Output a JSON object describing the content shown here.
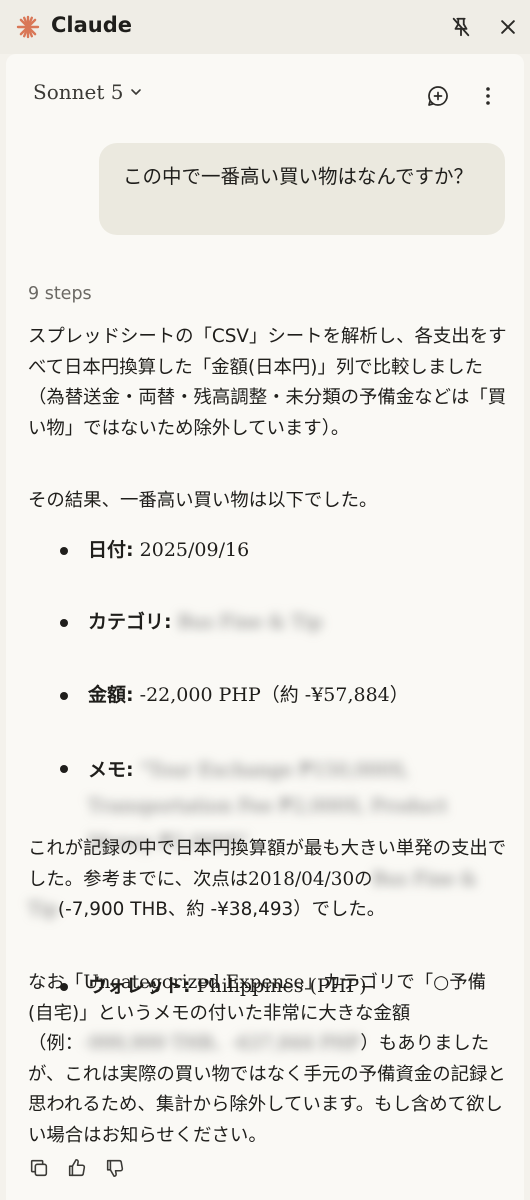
{
  "app": {
    "title": "Claude"
  },
  "header": {
    "model_name": "Sonnet 5"
  },
  "user_message": "この中で一番高い買い物はなんですか？",
  "steps_label": "9 steps",
  "response": {
    "para1": "スプレッドシートの「CSV」シートを解析し、各支出をすべて日本円換算した「金額(日本円)」列で比較しました（為替送金・両替・残高調整・未分類の予備金などは「買い物」ではないため除外しています）。",
    "para2": "その結果、一番高い買い物は以下でした。",
    "details": {
      "date_label": "日付:",
      "date_value": "2025/09/16",
      "category_label": "カテゴリ:",
      "category_value": "Bus Fine & Tip",
      "amount_label": "金額:",
      "amount_value": "-22,000 PHP（約 -¥57,884）",
      "memo_label": "メモ:",
      "memo_value": "\"Tour Exchange ₱150,000S, Transportation Fee ₱2,000S, Product Money ₱2,000S\"",
      "wallet_label": "ウォレット:",
      "wallet_value": "Philippines (PHP)"
    },
    "para3_a": "これが記録の中で日本円換算額が最も大きい単発の支出でした。参考までに、次点は",
    "para3_date": "2018/04/30",
    "para3_b": "の",
    "para3_blur": "Bus Fine & Tip",
    "para3_c": "(-7,900 THB、約 -¥38,493）でした。",
    "para4_a": "なお「",
    "para4_cat": "Uncategorized Expense",
    "para4_b": "」カテゴリで「○予備(自宅)」というメモの付いた非常に大きな金額（例：",
    "para4_blur": "-999,999 THB、-637,844 PHP",
    "para4_c": "）もありましたが、これは実際の買い物ではなく手元の予備資金の記録と思われるため、集計から除外しています。もし含めて欲しい場合はお知らせください。"
  },
  "colors": {
    "accent": "#d97757",
    "background": "#faf9f5",
    "bubble": "#ebe9df"
  }
}
